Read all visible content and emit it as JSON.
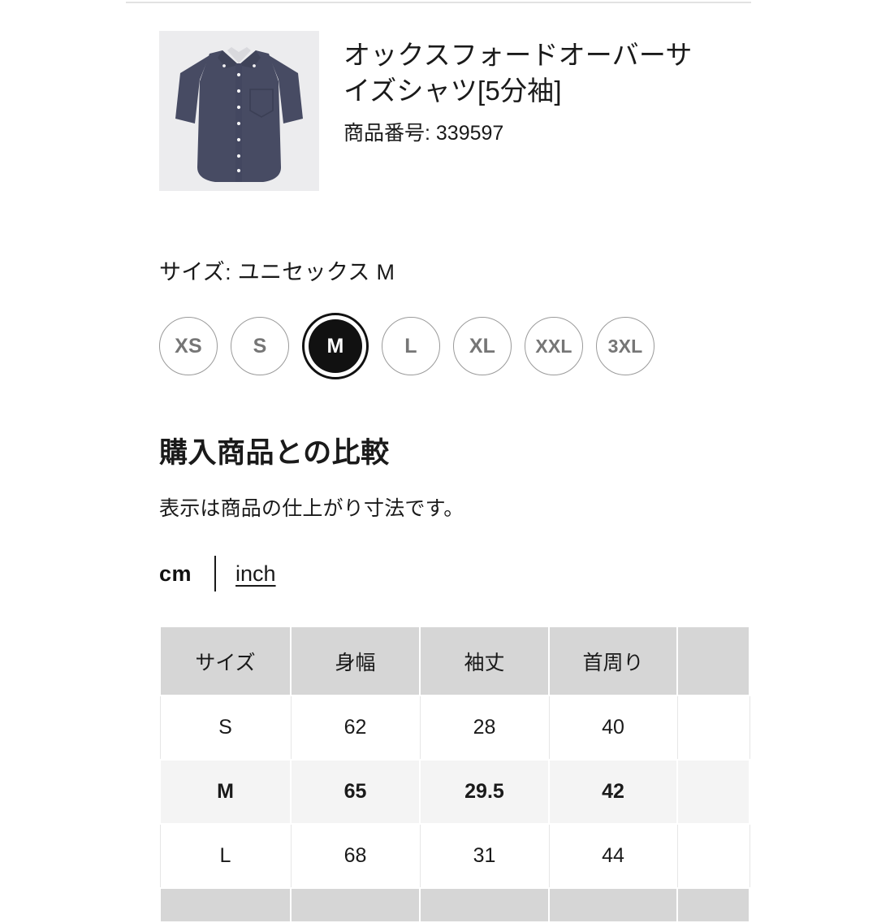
{
  "product": {
    "thumbnail_icon": "navy-oxford-shirt-image",
    "title": "オックスフォードオーバーサイズシャツ[5分袖]",
    "product_number_label": "商品番号: 339597",
    "image_bg_color": "#ececee",
    "shirt_color": "#474b63"
  },
  "size_section": {
    "label": "サイズ: ユニセックス M",
    "selected": "M",
    "options": [
      {
        "label": "XS",
        "selected": false
      },
      {
        "label": "S",
        "selected": false
      },
      {
        "label": "M",
        "selected": true
      },
      {
        "label": "L",
        "selected": false
      },
      {
        "label": "XL",
        "selected": false
      },
      {
        "label": "XXL",
        "selected": false
      },
      {
        "label": "3XL",
        "selected": false
      }
    ]
  },
  "compare_section": {
    "heading": "購入商品との比較",
    "note": "表示は商品の仕上がり寸法です。",
    "units": {
      "active": "cm",
      "cm_label": "cm",
      "inch_label": "inch"
    }
  },
  "size_table": {
    "headers": [
      "サイズ",
      "身幅",
      "袖丈",
      "首周り",
      ""
    ],
    "rows": [
      {
        "highlight": false,
        "cells": [
          "S",
          "62",
          "28",
          "40",
          ""
        ]
      },
      {
        "highlight": true,
        "cells": [
          "M",
          "65",
          "29.5",
          "42",
          ""
        ]
      },
      {
        "highlight": false,
        "cells": [
          "L",
          "68",
          "31",
          "44",
          ""
        ]
      }
    ],
    "partial_row_visible": true,
    "header_bg": "#d6d6d6",
    "highlight_bg": "#f4f4f4"
  }
}
